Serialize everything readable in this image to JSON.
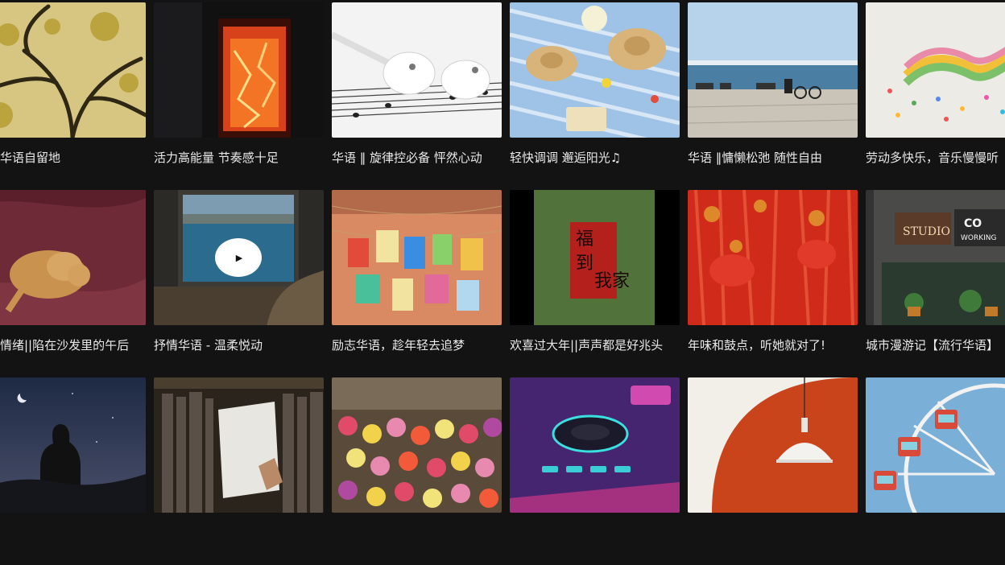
{
  "playlists": [
    {
      "title": "秋大华语自留地",
      "thumb": "yellow-tree-branches"
    },
    {
      "title": "活力高能量 节奏感十足",
      "thumb": "neon-red-door"
    },
    {
      "title": "华语 ‖ 旋律控必备 怦然心动",
      "thumb": "earbuds-on-sheet-music"
    },
    {
      "title": "轻快调调 邂逅阳光♫",
      "thumb": "picnic-straw-hats"
    },
    {
      "title": "华语 ‖慵懒松弛 随性自由",
      "thumb": "seaside-bench"
    },
    {
      "title": "劳动多快乐，音乐慢慢听",
      "thumb": "rainbow-ribbon-confetti"
    },
    {
      "title": "慵懒情绪||陷在沙发里的午后",
      "thumb": "sleeping-cat-on-blanket"
    },
    {
      "title": "抒情华语 - 温柔悦动",
      "thumb": "train-window-sea",
      "has_play": true
    },
    {
      "title": "励志华语，趁年轻去追梦",
      "thumb": "hanging-wish-cards"
    },
    {
      "title": "欢喜过大年||声声都是好兆头",
      "thumb": "fu-dao-wo-jia-banner"
    },
    {
      "title": "年味和鼓点，听她就对了!",
      "thumb": "red-lanterns-tree"
    },
    {
      "title": "城市漫游记【流行华语】",
      "thumb": "studio-co-working-storefront"
    },
    {
      "title": "",
      "thumb": "night-sky-silhouette"
    },
    {
      "title": "",
      "thumb": "bookshelf-hand-book"
    },
    {
      "title": "",
      "thumb": "flower-market"
    },
    {
      "title": "",
      "thumb": "dj-controller-neon"
    },
    {
      "title": "",
      "thumb": "orange-wall-lamp"
    },
    {
      "title": "",
      "thumb": "ferris-wheel-blue-sky"
    }
  ],
  "play_icon": "play-icon",
  "play_glyph": "▶"
}
